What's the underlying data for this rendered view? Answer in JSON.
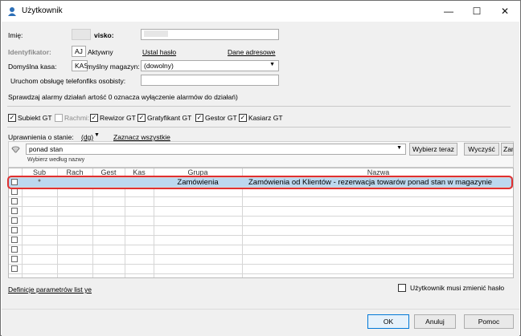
{
  "window": {
    "title": "Użytkownik",
    "minimize": "—",
    "maximize": "☐",
    "close": "✕"
  },
  "form": {
    "imie_label": "Imię:",
    "nazwisko_label": "visko:",
    "identyfikator_label": "Identyfikator:",
    "identyfikator_value": "AJ",
    "aktywny_label": "Aktywny",
    "ustal_haslo": "Ustal hasło",
    "dane_adresowe": "Dane adresowe",
    "kasa_label": "Domyślna kasa:",
    "kasa_value": "KAS",
    "magazyn_label": "myślny magazyn:",
    "magazyn_value": "(dowolny)",
    "telefon_label": "Uruchom obsługę telefonfiks osobisty:",
    "alarm_text": "Sprawdzaj alarmy działań artość 0 oznacza wyłączenie alarmów do działań)"
  },
  "modules": [
    {
      "label": "Subiekt GT",
      "checked": true,
      "disabled": false
    },
    {
      "label": "Rachmi:",
      "checked": false,
      "disabled": true
    },
    {
      "label": "Rewizor GT",
      "checked": true,
      "disabled": false
    },
    {
      "label": "Gratyfikant GT",
      "checked": true,
      "disabled": false
    },
    {
      "label": "Gestor GT",
      "checked": true,
      "disabled": false
    },
    {
      "label": "Kasiarz GT",
      "checked": true,
      "disabled": false
    }
  ],
  "permissions": {
    "label": "Uprawnienia o stanie:",
    "filter_value": "(dg)",
    "select_all": "Zaznacz wszystkie",
    "search_value": "ponad stan",
    "search_hint": "Wybierz według nazwy",
    "btn_choose": "Wybierz teraz",
    "btn_clear": "Wyczyść",
    "btn_close": "Zamknij"
  },
  "grid": {
    "columns": [
      "Sub",
      "Rach",
      "Gest",
      "Kas",
      "Grupa",
      "Nazwa"
    ],
    "rows": [
      {
        "sub": "●",
        "rach": "",
        "gest": "",
        "kas": "",
        "grupa": "Zamówienia",
        "nazwa": "Zamówienia od Klientów - rezerwacja towarów ponad stan w magazynie"
      }
    ]
  },
  "footer_link": "Definicje parametrów list ye",
  "must_change_password": "Użytkownik musi zmienić hasło",
  "buttons": {
    "ok": "OK",
    "cancel": "Anuluj",
    "help": "Pomoc"
  }
}
